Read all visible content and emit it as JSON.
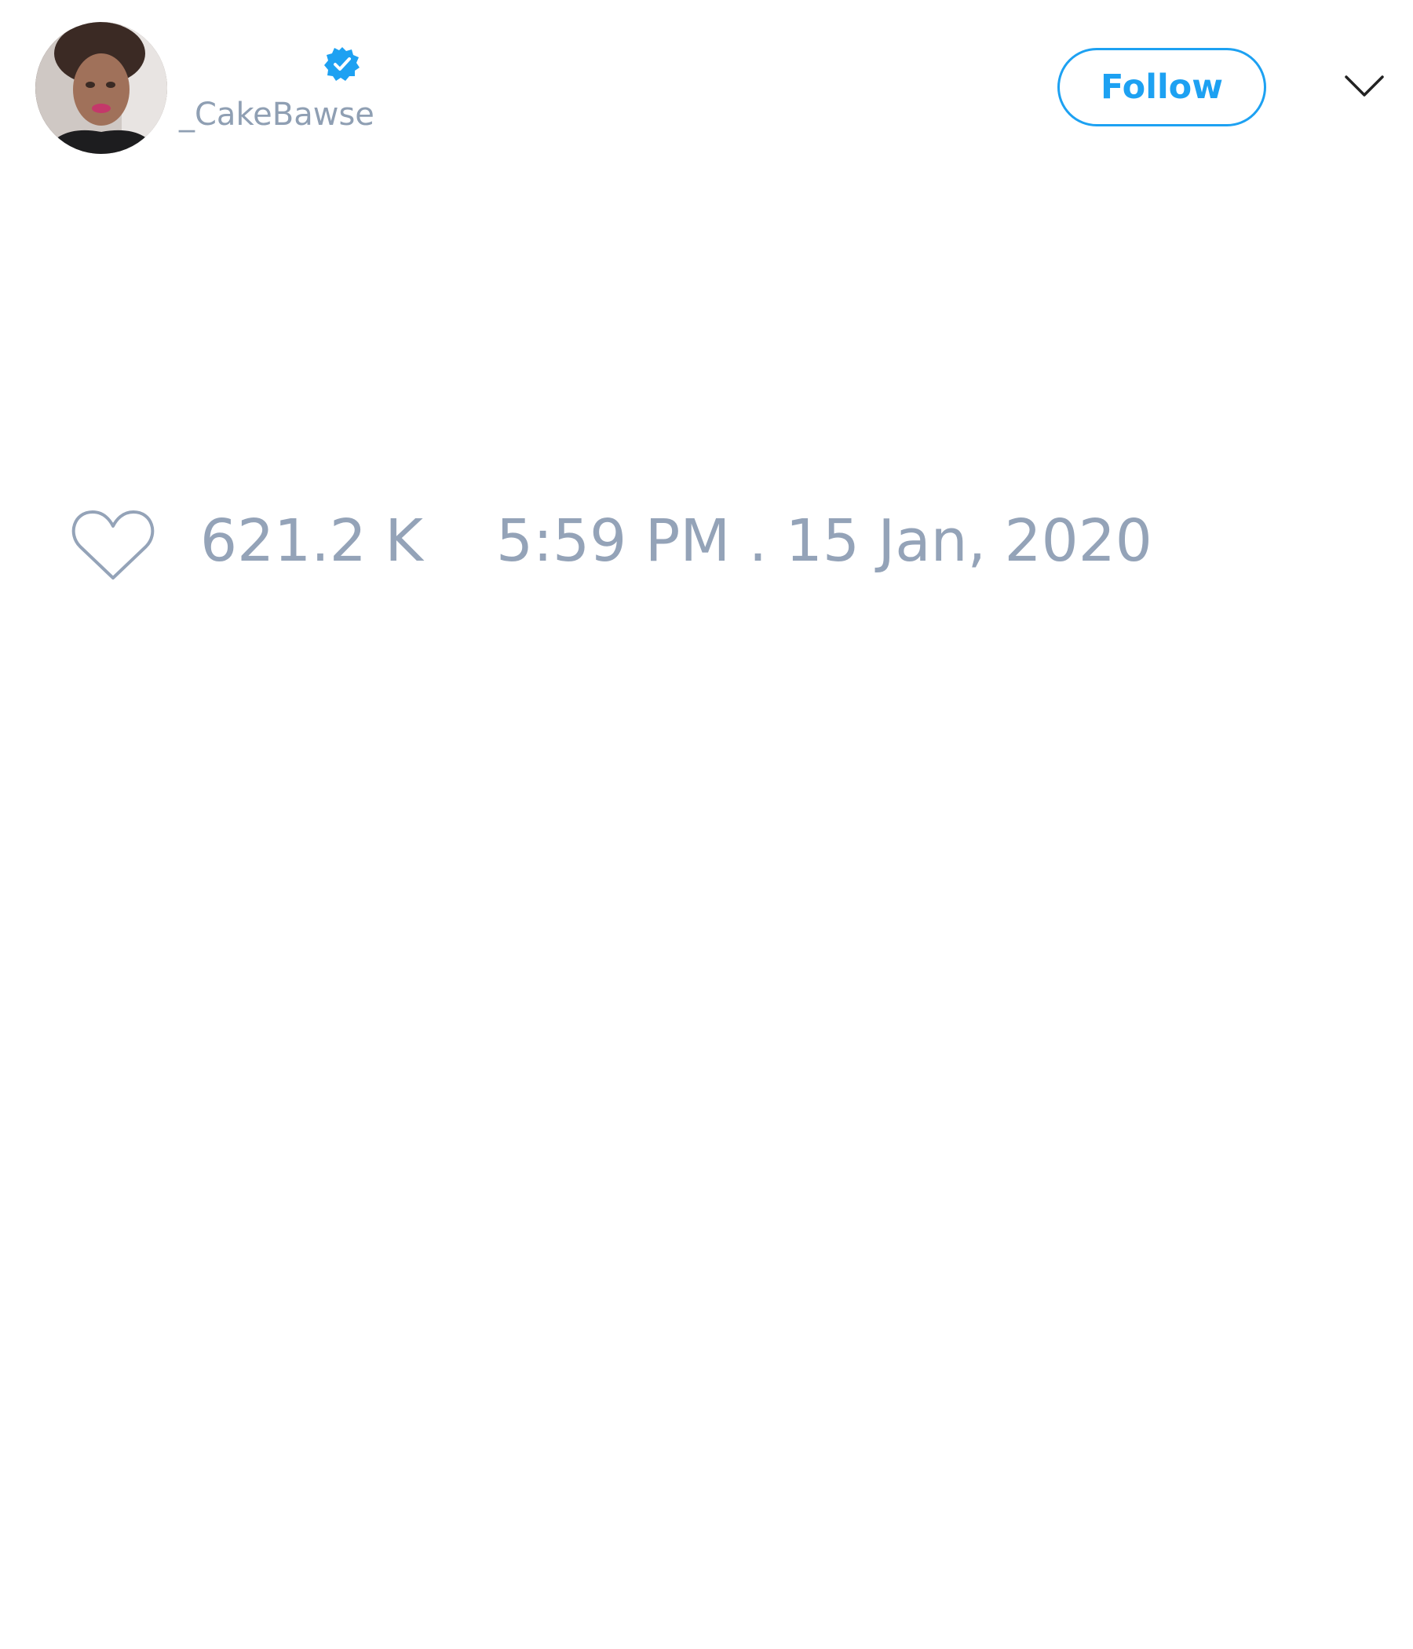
{
  "tweet": {
    "author": {
      "handle": "_CakeBawse",
      "verified": true
    },
    "follow_label": "Follow",
    "likes": "621.2 K",
    "timestamp": "5:59 PM . 15 Jan, 2020"
  },
  "icons": {
    "verified": "verified-badge-icon",
    "menu": "chevron-down-icon",
    "like": "heart-icon"
  },
  "colors": {
    "accent": "#1da1f2",
    "muted_text": "#94a3b8",
    "handle_text": "#8f9fb3",
    "background": "#ffffff"
  }
}
